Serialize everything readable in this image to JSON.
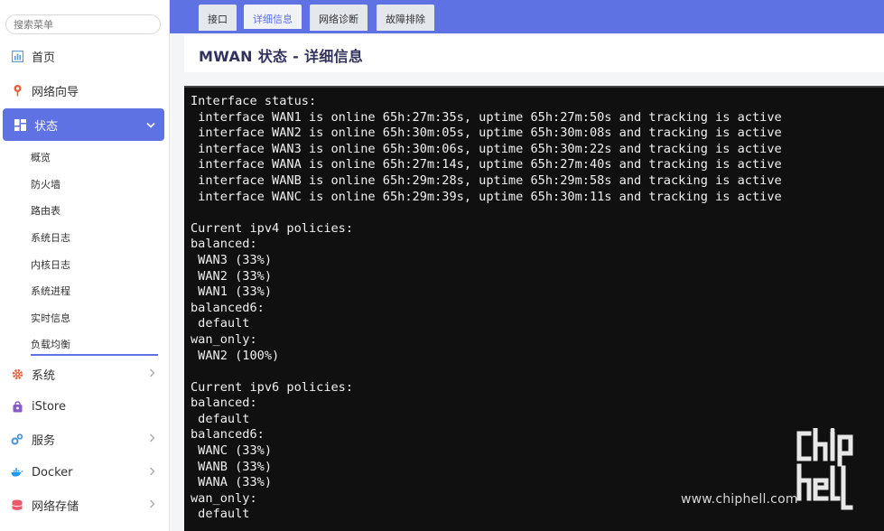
{
  "sidebar": {
    "search_placeholder": "搜索菜单",
    "items": [
      {
        "label": "首页",
        "icon": "dashboard-icon"
      },
      {
        "label": "网络向导",
        "icon": "wizard-icon"
      },
      {
        "label": "状态",
        "icon": "status-grid-icon",
        "active": true
      },
      {
        "label": "系统",
        "icon": "gear-icon"
      },
      {
        "label": "iStore",
        "icon": "store-icon"
      },
      {
        "label": "服务",
        "icon": "services-icon"
      },
      {
        "label": "Docker",
        "icon": "docker-icon"
      },
      {
        "label": "网络存储",
        "icon": "storage-icon"
      }
    ],
    "sub_items": [
      "概览",
      "防火墙",
      "路由表",
      "系统日志",
      "内核日志",
      "系统进程",
      "实时信息",
      "负载均衡"
    ]
  },
  "tabs": [
    "接口",
    "详细信息",
    "网络诊断",
    "故障排除"
  ],
  "active_tab": "详细信息",
  "page_title": "MWAN 状态 - 详细信息",
  "terminal_output": "Interface status:\n interface WAN1 is online 65h:27m:35s, uptime 65h:27m:50s and tracking is active\n interface WAN2 is online 65h:30m:05s, uptime 65h:30m:08s and tracking is active\n interface WAN3 is online 65h:30m:06s, uptime 65h:30m:22s and tracking is active\n interface WANA is online 65h:27m:14s, uptime 65h:27m:40s and tracking is active\n interface WANB is online 65h:29m:28s, uptime 65h:29m:58s and tracking is active\n interface WANC is online 65h:29m:39s, uptime 65h:30m:11s and tracking is active\n\nCurrent ipv4 policies:\nbalanced:\n WAN3 (33%)\n WAN2 (33%)\n WAN1 (33%)\nbalanced6:\n default\nwan_only:\n WAN2 (100%)\n\nCurrent ipv6 policies:\nbalanced:\n default\nbalanced6:\n WANC (33%)\n WANB (33%)\n WANA (33%)\nwan_only:\n default",
  "watermark": {
    "text": "www.chiphell.com",
    "logo_text": "chip hell"
  },
  "colors": {
    "accent": "#5e72e4",
    "terminal_bg": "#101010",
    "terminal_fg": "#f0f0f0"
  }
}
